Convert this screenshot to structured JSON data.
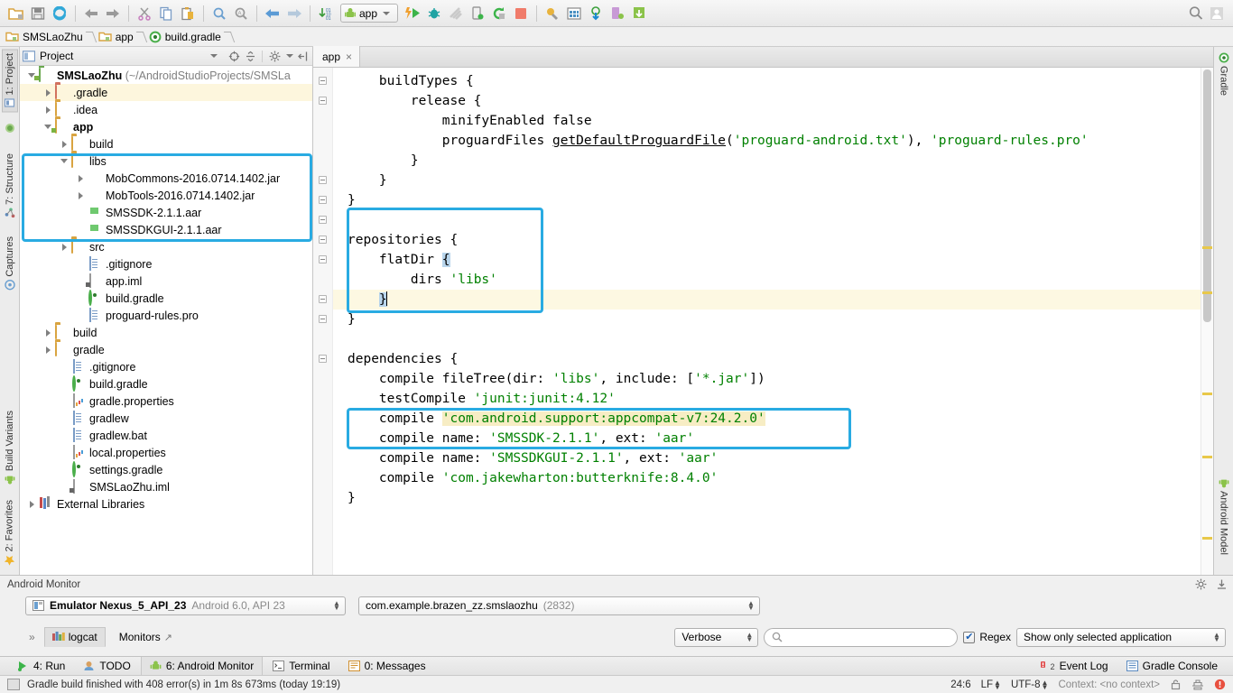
{
  "toolbar": {
    "icons": [
      "open-folder-icon",
      "save-all-icon",
      "sync-icon",
      "undo-icon",
      "redo-icon",
      "cut-icon",
      "copy-icon",
      "paste-icon",
      "find-icon",
      "find-replace-icon",
      "back-icon",
      "forward-icon",
      "sort-icon"
    ],
    "run_config": "app",
    "right_icons": [
      "search-everywhere-icon",
      "user-account-icon"
    ]
  },
  "breadcrumb": {
    "items": [
      "SMSLaoZhu",
      "app",
      "build.gradle"
    ]
  },
  "left_tool_tabs": [
    {
      "label": "1: Project",
      "icon": "project-icon"
    },
    {
      "label": "7: Structure",
      "icon": "structure-icon"
    },
    {
      "label": "Captures",
      "icon": "captures-icon"
    },
    {
      "label": "Build Variants",
      "icon": "android-icon"
    },
    {
      "label": "2: Favorites",
      "icon": "star-icon"
    }
  ],
  "right_tool_tabs": [
    {
      "label": "Gradle",
      "icon": "gradle-icon"
    },
    {
      "label": "Android Model",
      "icon": "android-icon"
    }
  ],
  "project_panel": {
    "title": "Project",
    "tools": [
      "collapse-target-icon",
      "collapse-all-icon",
      "settings-gear-icon",
      "hide-panel-icon"
    ],
    "tree": [
      {
        "label": "SMSLaoZhu",
        "suffix": " (~/AndroidStudioProjects/SMSLa",
        "depth": 0,
        "arrow": "open",
        "icon": "project-root-icon",
        "bold": true,
        "selected": false
      },
      {
        "label": ".gradle",
        "depth": 1,
        "arrow": "closed",
        "icon": "folder-red-icon",
        "selected": true
      },
      {
        "label": ".idea",
        "depth": 1,
        "arrow": "closed",
        "icon": "folder-icon",
        "selected": false
      },
      {
        "label": "app",
        "depth": 1,
        "arrow": "open",
        "icon": "module-folder-icon",
        "bold": true,
        "selected": false
      },
      {
        "label": "build",
        "depth": 2,
        "arrow": "closed",
        "icon": "folder-icon",
        "selected": false
      },
      {
        "label": "libs",
        "depth": 2,
        "arrow": "open",
        "icon": "folder-icon",
        "selected": false
      },
      {
        "label": "MobCommons-2016.0714.1402.jar",
        "depth": 3,
        "arrow": "closed",
        "icon": "jar-icon",
        "selected": false
      },
      {
        "label": "MobTools-2016.0714.1402.jar",
        "depth": 3,
        "arrow": "closed",
        "icon": "jar-icon",
        "selected": false
      },
      {
        "label": "SMSSDK-2.1.1.aar",
        "depth": 3,
        "arrow": "none",
        "icon": "aar-icon",
        "selected": false
      },
      {
        "label": "SMSSDKGUI-2.1.1.aar",
        "depth": 3,
        "arrow": "none",
        "icon": "aar-icon",
        "selected": false
      },
      {
        "label": "src",
        "depth": 2,
        "arrow": "closed",
        "icon": "folder-icon",
        "selected": false
      },
      {
        "label": ".gitignore",
        "depth": 3,
        "arrow": "none",
        "icon": "file-icon",
        "selected": false
      },
      {
        "label": "app.iml",
        "depth": 3,
        "arrow": "none",
        "icon": "iml-file-icon",
        "selected": false
      },
      {
        "label": "build.gradle",
        "depth": 3,
        "arrow": "none",
        "icon": "gradle-file-icon",
        "selected": false
      },
      {
        "label": "proguard-rules.pro",
        "depth": 3,
        "arrow": "none",
        "icon": "file-icon",
        "selected": false
      },
      {
        "label": "build",
        "depth": 1,
        "arrow": "closed",
        "icon": "folder-icon",
        "selected": false
      },
      {
        "label": "gradle",
        "depth": 1,
        "arrow": "closed",
        "icon": "folder-icon",
        "selected": false
      },
      {
        "label": ".gitignore",
        "depth": 2,
        "arrow": "none",
        "icon": "file-icon",
        "selected": false
      },
      {
        "label": "build.gradle",
        "depth": 2,
        "arrow": "none",
        "icon": "gradle-file-icon",
        "selected": false
      },
      {
        "label": "gradle.properties",
        "depth": 2,
        "arrow": "none",
        "icon": "properties-file-icon",
        "selected": false
      },
      {
        "label": "gradlew",
        "depth": 2,
        "arrow": "none",
        "icon": "file-icon",
        "selected": false
      },
      {
        "label": "gradlew.bat",
        "depth": 2,
        "arrow": "none",
        "icon": "file-icon",
        "selected": false
      },
      {
        "label": "local.properties",
        "depth": 2,
        "arrow": "none",
        "icon": "properties-file-icon",
        "selected": false
      },
      {
        "label": "settings.gradle",
        "depth": 2,
        "arrow": "none",
        "icon": "gradle-file-icon",
        "selected": false
      },
      {
        "label": "SMSLaoZhu.iml",
        "depth": 2,
        "arrow": "none",
        "icon": "iml-file-icon",
        "selected": false
      },
      {
        "label": "External Libraries",
        "depth": 0,
        "arrow": "closed",
        "icon": "library-icon",
        "selected": false
      }
    ]
  },
  "editor": {
    "tab": "app",
    "tab_close": "×",
    "lines": [
      {
        "id": "l1",
        "text": "    buildTypes {"
      },
      {
        "id": "l2",
        "text": "        release {"
      },
      {
        "id": "l3",
        "text": "            minifyEnabled false"
      },
      {
        "id": "l4",
        "text": "            proguardFiles getDefaultProguardFile('proguard-android.txt'), 'proguard-rules.pro'"
      },
      {
        "id": "l5",
        "text": "        }"
      },
      {
        "id": "l6",
        "text": "    }"
      },
      {
        "id": "l7",
        "text": "}"
      },
      {
        "id": "l8",
        "text": ""
      },
      {
        "id": "l9",
        "text": "repositories {"
      },
      {
        "id": "l10",
        "text": "    flatDir {"
      },
      {
        "id": "l11",
        "text": "        dirs 'libs'"
      },
      {
        "id": "l12",
        "text": "    }"
      },
      {
        "id": "l13",
        "text": "}"
      },
      {
        "id": "l14",
        "text": ""
      },
      {
        "id": "l15",
        "text": "dependencies {"
      },
      {
        "id": "l16",
        "text": "    compile fileTree(dir: 'libs', include: ['*.jar'])"
      },
      {
        "id": "l17",
        "text": "    testCompile 'junit:junit:4.12'"
      },
      {
        "id": "l18",
        "text": "    compile 'com.android.support:appcompat-v7:24.2.0'"
      },
      {
        "id": "l19",
        "text": "    compile name: 'SMSSDK-2.1.1', ext: 'aar'"
      },
      {
        "id": "l20",
        "text": "    compile name: 'SMSSDKGUI-2.1.1', ext: 'aar'"
      },
      {
        "id": "l21",
        "text": "    compile 'com.jakewharton:butterknife:8.4.0'"
      },
      {
        "id": "l22",
        "text": "}"
      }
    ]
  },
  "android_monitor": {
    "title": "Android Monitor",
    "device": "Emulator Nexus_5_API_23",
    "device_detail": "Android 6.0, API 23",
    "process": "com.example.brazen_zz.smslaozhu",
    "process_pid": "(2832)",
    "tabs": [
      {
        "label": "logcat",
        "active": true
      },
      {
        "label": "Monitors",
        "active": false
      }
    ],
    "log_level": "Verbose",
    "search_placeholder": "",
    "regex_label": "Regex",
    "regex_checked": true,
    "filter": "Show only selected application"
  },
  "tool_tabs_bottom": [
    {
      "label": "4: Run",
      "mnemonic": "4",
      "icon": "run-icon",
      "active": false
    },
    {
      "label": "TODO",
      "icon": "todo-icon",
      "active": false
    },
    {
      "label": "6: Android Monitor",
      "mnemonic": "6",
      "icon": "android-icon",
      "active": true
    },
    {
      "label": "Terminal",
      "icon": "terminal-icon",
      "active": false
    },
    {
      "label": "0: Messages",
      "mnemonic": "0",
      "icon": "messages-icon",
      "active": false
    }
  ],
  "tool_tabs_bottom_right": [
    {
      "label": "Event Log",
      "icon": "event-log-icon",
      "badge": "2"
    },
    {
      "label": "Gradle Console",
      "icon": "gradle-console-icon"
    }
  ],
  "status_bar": {
    "message": "Gradle build finished with 408 error(s) in 1m 8s 673ms (today 19:19)",
    "caret_position": "24:6",
    "line_separator": "LF",
    "encoding": "UTF-8",
    "context": "Context: <no context>",
    "icons": [
      "lock-icon",
      "hide-icon",
      "inspection-error-icon"
    ]
  },
  "colors": {
    "highlight_box": "#29abe2",
    "string": "#008000",
    "selection": "#b8d5ec",
    "occurrence": "#f7edc4",
    "current_line": "#fdf8e2",
    "tree_selection": "#fdf6dd"
  }
}
